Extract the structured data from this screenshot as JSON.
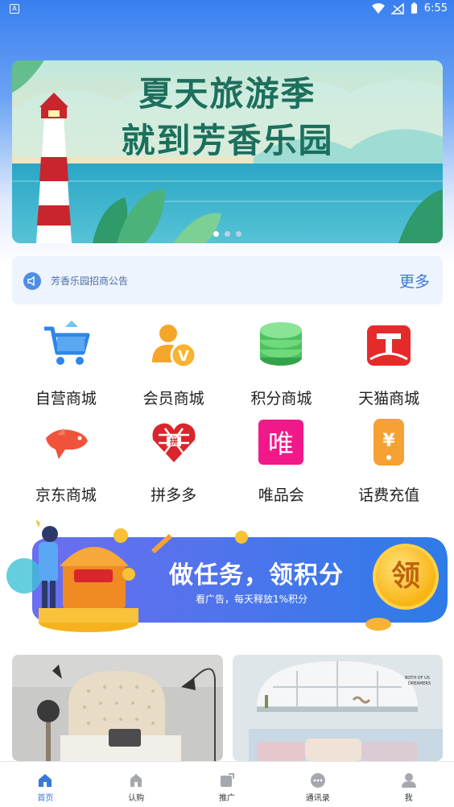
{
  "status_bar": {
    "time": "6:55",
    "left_indicator": "A",
    "icons": [
      "wifi-icon",
      "signal-off-icon",
      "battery-icon"
    ]
  },
  "banner": {
    "line1": "夏天旅游季",
    "line2": "就到芳香乐园",
    "dots": 3,
    "active_dot": 0
  },
  "notice": {
    "icon": "speaker-icon",
    "text": "芳香乐园招商公告",
    "more": "更多"
  },
  "grid": [
    {
      "label": "自营商城",
      "icon": "cart-icon"
    },
    {
      "label": "会员商城",
      "icon": "member-icon"
    },
    {
      "label": "积分商城",
      "icon": "coin-stack-icon"
    },
    {
      "label": "天猫商城",
      "icon": "tmall-icon"
    },
    {
      "label": "京东商城",
      "icon": "jd-dog-icon"
    },
    {
      "label": "拼多多",
      "icon": "pinduoduo-icon"
    },
    {
      "label": "唯品会",
      "icon": "vip-icon"
    },
    {
      "label": "话费充值",
      "icon": "phone-recharge-icon"
    }
  ],
  "promo": {
    "title": "做任务，领积分",
    "subtitle": "看广告，每天释放1%积分",
    "button": "领"
  },
  "tabs": [
    {
      "label": "首页",
      "icon": "home-icon",
      "active": true
    },
    {
      "label": "认购",
      "icon": "shop-icon",
      "active": false
    },
    {
      "label": "推广",
      "icon": "promote-icon",
      "active": false
    },
    {
      "label": "通讯录",
      "icon": "chat-icon",
      "active": false
    },
    {
      "label": "我",
      "icon": "user-icon",
      "active": false
    }
  ],
  "colors": {
    "primary": "#3a78d8",
    "notice_bg": "#eef4fd",
    "header_gradient_top": "#3a7ff0"
  }
}
